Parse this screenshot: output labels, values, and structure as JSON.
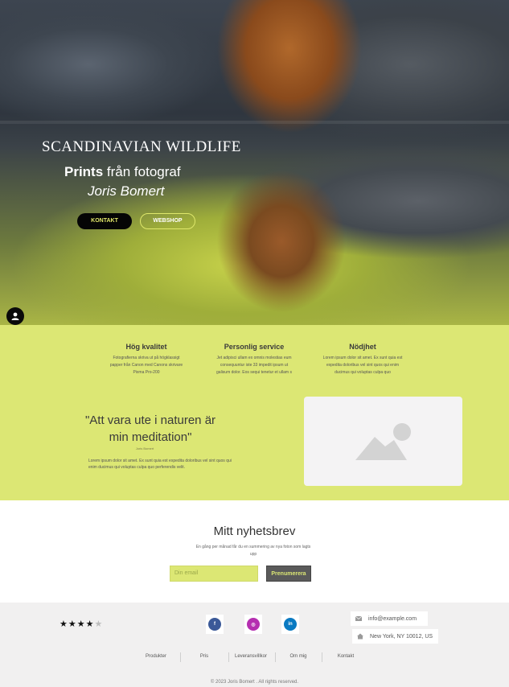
{
  "hero": {
    "title": "SCANDINAVIAN WILDLIFE",
    "subtitle_bold": "Prints",
    "subtitle_rest": " från fotograf",
    "photographer": "Joris Bomert",
    "btn_contact": "KONTAKT",
    "btn_webshop": "WEBSHOP"
  },
  "features": [
    {
      "title": "Hög kvalitet",
      "text": "Fotografierna skriva ut på högklassigt papper från Canon med Canons skrivare Pixma Pro-200"
    },
    {
      "title": "Personlig service",
      "text": "Jet adipisci ullam ex omnis molestias eum consequuntur iste 33 impedit ipsum ut galisum dolor. Eos sequi tenetur et ullam s"
    },
    {
      "title": "Nödjhet",
      "text": "Lorem ipsum dolor sit amet. Ex sunt quia est expedita doloribus vel sint quos qui enim ducimus qui voluptas culpa quo"
    }
  ],
  "quote": {
    "text": "\"Att vara ute i naturen är min meditation\"",
    "author": "Joris Bomert",
    "body": "Lorem ipsum dolor sit amet. Ex sunt quia est expedita doloribus vel sint quos qui enim ducimus qui voluptas culpa quo perferendis velit."
  },
  "newsletter": {
    "title": "Mitt nyhetsbrev",
    "desc": "En gång per månad får du en summering av nya foton som lagts upp",
    "placeholder": "Din email",
    "button": "Prenumerera"
  },
  "footer": {
    "rating": 4,
    "rating_max": 5,
    "social": [
      {
        "name": "facebook",
        "letter": "f",
        "color": "#3b5998"
      },
      {
        "name": "instagram",
        "letter": "◎",
        "color": "#b52fb0"
      },
      {
        "name": "linkedin",
        "letter": "in",
        "color": "#0a7ac2"
      }
    ],
    "email": "info@example.com",
    "address": "New York, NY 10012, US",
    "nav": [
      "Produkter",
      "Pris",
      "Leveransvillkor",
      "Om mig",
      "Kontakt"
    ],
    "copyright": "© 2023 Joris Bomert . All rights reserved."
  },
  "colors": {
    "accent": "#dce774",
    "dark": "#050505"
  }
}
